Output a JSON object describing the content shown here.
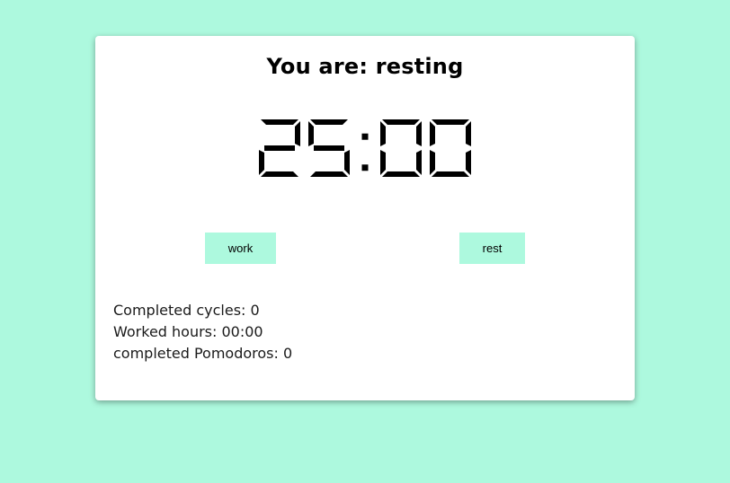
{
  "colors": {
    "background": "#adf9de",
    "card": "#ffffff",
    "button_bg": "#adf9de",
    "text": "#000000"
  },
  "status": {
    "title": "You are: resting"
  },
  "timer": {
    "display": "25:00"
  },
  "controls": {
    "work_label": "work",
    "rest_label": "rest"
  },
  "stats": {
    "completed_cycles_label": "Completed cycles:",
    "completed_cycles_value": "0",
    "worked_hours_label": "Worked hours:",
    "worked_hours_value": "00:00",
    "completed_pomodoros_label": "completed Pomodoros:",
    "completed_pomodoros_value": "0"
  }
}
